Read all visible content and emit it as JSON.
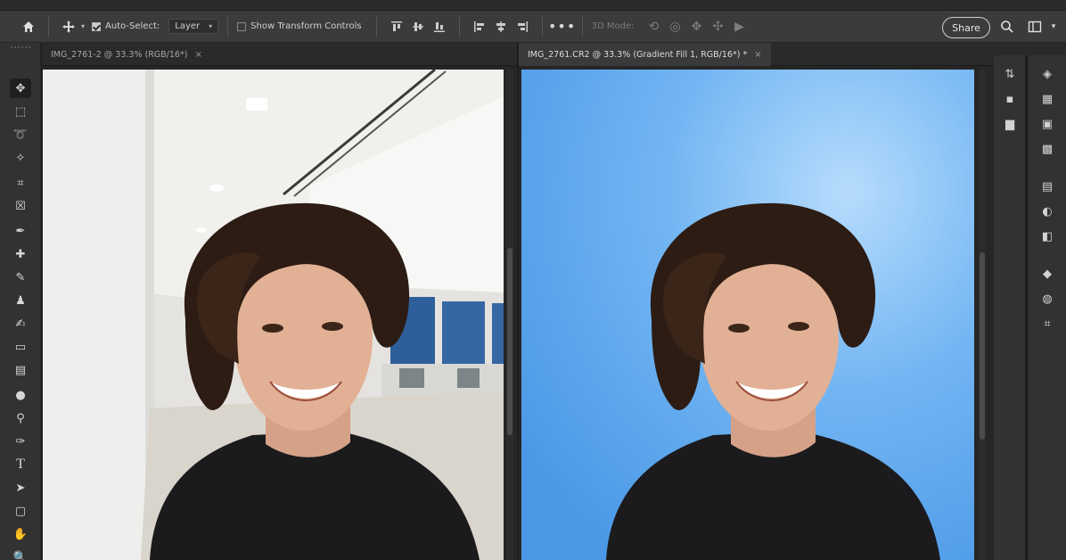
{
  "options_bar": {
    "auto_select_label": "Auto-Select:",
    "auto_select_target": "Layer",
    "show_transform_label": "Show Transform Controls",
    "mode_3d_label": "3D Mode:",
    "share_label": "Share"
  },
  "documents": [
    {
      "tab_label": "IMG_2761-2 @ 33.3% (RGB/16*)",
      "active": false
    },
    {
      "tab_label": "IMG_2761.CR2 @ 33.3% (Gradient Fill 1, RGB/16*) *",
      "active": true
    }
  ],
  "tools": [
    "move-tool-icon",
    "marquee-tool-icon",
    "lasso-tool-icon",
    "object-select-tool-icon",
    "crop-tool-icon",
    "frame-tool-icon",
    "eyedropper-tool-icon",
    "healing-brush-icon",
    "brush-tool-icon",
    "clone-stamp-icon",
    "history-brush-icon",
    "eraser-tool-icon",
    "gradient-tool-icon",
    "blur-tool-icon",
    "dodge-tool-icon",
    "pen-tool-icon",
    "type-tool-icon",
    "path-select-icon",
    "rectangle-tool-icon",
    "hand-tool-icon",
    "zoom-tool-icon"
  ],
  "colors": {
    "ui_dark": "#323232",
    "options_bar": "#3b3b3b",
    "gradient_bg_light": "#a9d5fb",
    "gradient_bg_dark": "#4d9ce9"
  }
}
